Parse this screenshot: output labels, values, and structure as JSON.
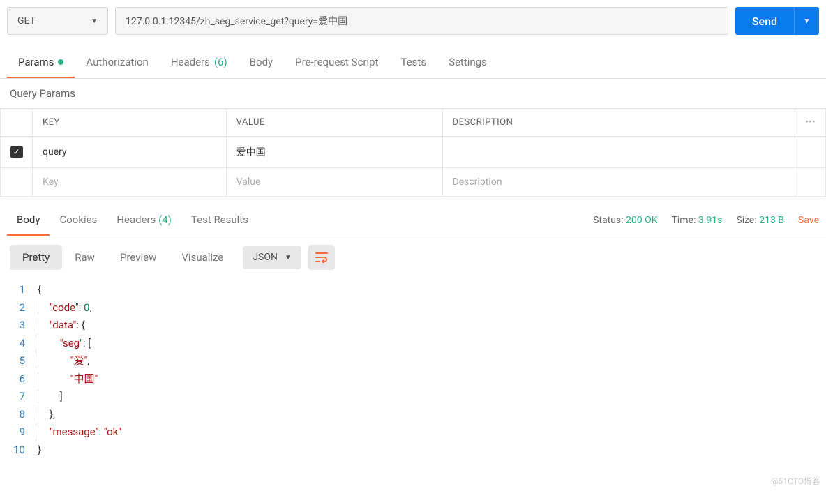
{
  "request": {
    "method": "GET",
    "url": "127.0.0.1:12345/zh_seg_service_get?query=爱中国",
    "send_label": "Send"
  },
  "tabs": {
    "params": "Params",
    "authorization": "Authorization",
    "headers": "Headers",
    "headers_count": "(6)",
    "body": "Body",
    "prerequest": "Pre-request Script",
    "tests": "Tests",
    "settings": "Settings"
  },
  "section": {
    "query_params": "Query Params"
  },
  "table": {
    "key_header": "KEY",
    "value_header": "VALUE",
    "desc_header": "DESCRIPTION",
    "row1_key": "query",
    "row1_value": "爱中国",
    "key_placeholder": "Key",
    "value_placeholder": "Value",
    "desc_placeholder": "Description"
  },
  "response_tabs": {
    "body": "Body",
    "cookies": "Cookies",
    "headers": "Headers",
    "headers_count": "(4)",
    "test_results": "Test Results"
  },
  "response_meta": {
    "status_label": "Status:",
    "status_value": "200 OK",
    "time_label": "Time:",
    "time_value": "3.91s",
    "size_label": "Size:",
    "size_value": "213 B",
    "save": "Save"
  },
  "view": {
    "pretty": "Pretty",
    "raw": "Raw",
    "preview": "Preview",
    "visualize": "Visualize",
    "format": "JSON"
  },
  "json_response": {
    "lines": [
      {
        "n": 1,
        "content": "{"
      },
      {
        "n": 2,
        "content": "    \"code\": 0,"
      },
      {
        "n": 3,
        "content": "    \"data\": {"
      },
      {
        "n": 4,
        "content": "        \"seg\": ["
      },
      {
        "n": 5,
        "content": "            \"爱\","
      },
      {
        "n": 6,
        "content": "            \"中国\""
      },
      {
        "n": 7,
        "content": "        ]"
      },
      {
        "n": 8,
        "content": "    },"
      },
      {
        "n": 9,
        "content": "    \"message\": \"ok\""
      },
      {
        "n": 10,
        "content": "}"
      }
    ]
  },
  "watermark": "@51CTO博客"
}
